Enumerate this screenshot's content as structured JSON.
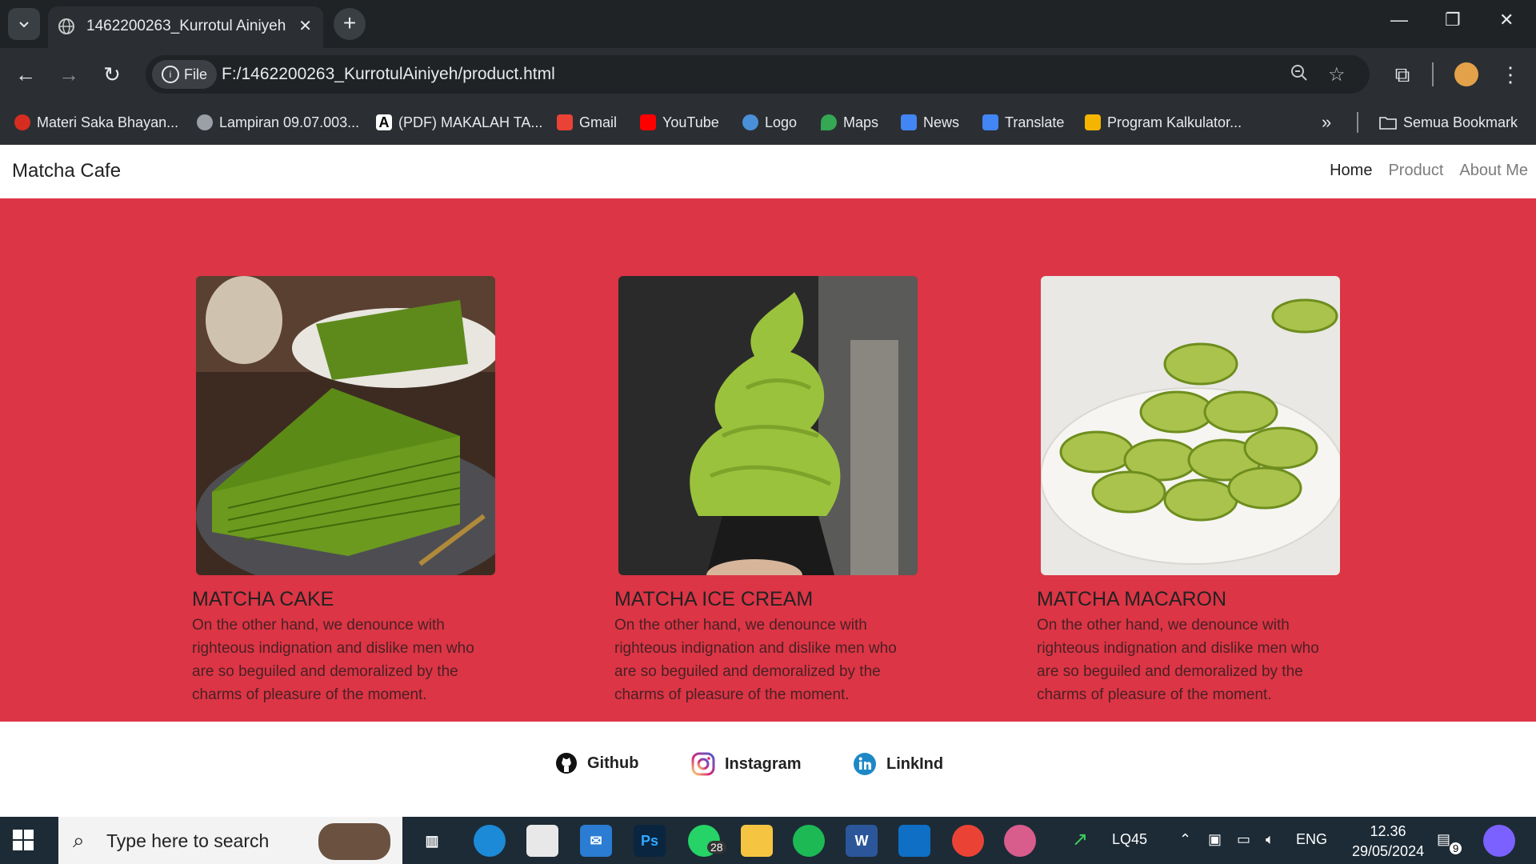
{
  "browser": {
    "tab_title": "1462200263_Kurrotul Ainiyeh",
    "url": "F:/1462200263_KurrotulAiniyeh/product.html",
    "file_chip_label": "File",
    "bookmarks": [
      {
        "label": "Materi Saka Bhayan...",
        "icon": "bookmark-favicon-red"
      },
      {
        "label": "Lampiran 09.07.003...",
        "icon": "globe-icon"
      },
      {
        "label": "(PDF) MAKALAH TA...",
        "icon": "academia-icon"
      },
      {
        "label": "Gmail",
        "icon": "gmail-icon"
      },
      {
        "label": "YouTube",
        "icon": "youtube-icon"
      },
      {
        "label": "Logo",
        "icon": "logo-icon"
      },
      {
        "label": "Maps",
        "icon": "maps-icon"
      },
      {
        "label": "News",
        "icon": "news-icon"
      },
      {
        "label": "Translate",
        "icon": "translate-icon"
      },
      {
        "label": "Program Kalkulator...",
        "icon": "kalkulator-icon"
      }
    ],
    "all_bookmarks_label": "Semua Bookmark"
  },
  "site": {
    "brand": "Matcha Cafe",
    "nav": [
      {
        "label": "Home"
      },
      {
        "label": "Product"
      },
      {
        "label": "About Me"
      }
    ],
    "products": [
      {
        "name": "MATCHA CAKE",
        "description": "On the other hand, we denounce with righteous indignation and dislike men who are so beguiled and demoralized by the charms of pleasure of the moment."
      },
      {
        "name": "MATCHA ICE CREAM",
        "description": "On the other hand, we denounce with righteous indignation and dislike men who are so beguiled and demoralized by the charms of pleasure of the moment."
      },
      {
        "name": "MATCHA MACARON",
        "description": "On the other hand, we denounce with righteous indignation and dislike men who are so beguiled and demoralized by the charms of pleasure of the moment."
      }
    ],
    "footer_links": [
      {
        "label": "Github",
        "icon": "github-icon"
      },
      {
        "label": "Instagram",
        "icon": "instagram-icon"
      },
      {
        "label": "LinkInd",
        "icon": "linkedin-icon"
      }
    ],
    "colors": {
      "hero_bg": "#dc3545"
    }
  },
  "taskbar": {
    "search_placeholder": "Type here to search",
    "whatsapp_badge": "28",
    "stock_label": "LQ45",
    "language": "ENG",
    "time": "12.36",
    "date": "29/05/2024",
    "notification_count": "9"
  }
}
